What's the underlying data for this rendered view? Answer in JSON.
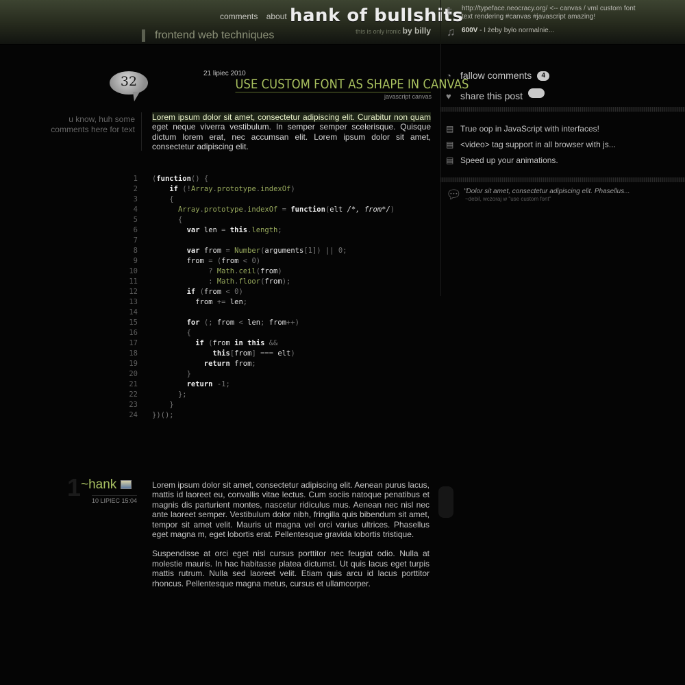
{
  "header": {
    "nav": [
      "comments",
      "about"
    ],
    "site_title": "hank of bullshits",
    "tagline_small": "this is only ironic",
    "tagline_by": "by billy",
    "subtitle": "frontend web techniques",
    "tweet": "http://typeface.neocracy.org/  <-- canvas / vml custom font text rendering #canvas #javascript amazing!",
    "now_playing_artist": "600V",
    "now_playing_rest": " - I żeby było normalnie..."
  },
  "sidebar": {
    "follow_comments": "fallow comments",
    "follow_count": "4",
    "share": "share this post",
    "recent_posts": [
      "True oop in JavaScript with interfaces!",
      "<video> tag support in all browser with js...",
      "Speed up your animations."
    ],
    "last_comment_quote": "\"Dolor sit amet, consectetur adipiscing elit. Phasellus...",
    "last_comment_meta": "~debil, wczoraj w \"use custom font\""
  },
  "post": {
    "comment_count": "32",
    "date": "21 lipiec 2010",
    "title": "USE CUSTOM FONT AS SHAPE IN CANVAS",
    "tags": "javascript canvas",
    "side_note": "u know, huh some comments here for text",
    "intro_highlight": "Lorem ipsum dolor sit amet, consectetur adipiscing elit. Curabitur non quam",
    "intro_rest": " eget neque viverra vestibulum. In semper semper scelerisque. Quisque dictum lorem erat, nec accumsan elit. Lorem ipsum dolor sit amet, consectetur adipiscing elit."
  },
  "code_lines": [
    "(function() {",
    "    if (!Array.prototype.indexOf)",
    "    {",
    "      Array.prototype.indexOf = function(elt /*, from*/)",
    "      {",
    "        var len = this.length;",
    "",
    "        var from = Number(arguments[1]) || 0;",
    "        from = (from < 0)",
    "             ? Math.ceil(from)",
    "             : Math.floor(from);",
    "        if (from < 0)",
    "          from += len;",
    "",
    "        for (; from < len; from++)",
    "        {",
    "          if (from in this &&",
    "              this[from] === elt)",
    "            return from;",
    "        }",
    "        return -1;",
    "      };",
    "    }",
    "})();"
  ],
  "comment": {
    "number": "1",
    "author": "~hank",
    "date": "10 LIPIEC 15:04",
    "paragraphs": [
      "Lorem ipsum dolor sit amet, consectetur adipiscing elit. Aenean purus lacus, mattis id laoreet eu, convallis vitae lectus. Cum sociis natoque penatibus et magnis dis parturient montes, nascetur ridiculus mus. Aenean nec nisl nec ante laoreet semper. Vestibulum dolor nibh, fringilla quis bibendum sit amet, tempor sit amet velit. Mauris ut magna vel orci varius ultrices. Phasellus eget magna m, eget lobortis erat. Pellentesque gravida lobortis tristique.",
      "Suspendisse at orci eget nisl cursus porttitor nec feugiat odio. Nulla at molestie mauris. In hac habitasse platea dictumst. Ut quis lacus eget turpis mattis rutrum. Nulla sed laoreet velit. Etiam quis arcu id lacus porttitor rhoncus. Pellentesque magna metus, cursus et ullamcorper."
    ]
  }
}
